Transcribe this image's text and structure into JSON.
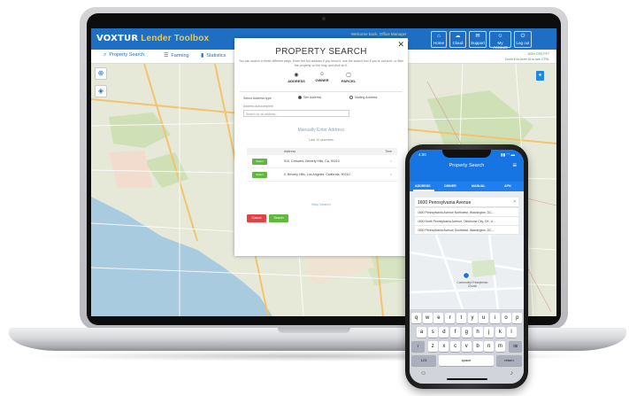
{
  "app": {
    "brand_prefix": "VOXTUR",
    "brand_suffix": "Lender Toolbox",
    "user_name": "Welcome back, Office Manager",
    "user_id": "User ID: 0123 (LEN)"
  },
  "header_nav": [
    {
      "label": "Home",
      "icon": "⌂"
    },
    {
      "label": "Cloud",
      "icon": "☁"
    },
    {
      "label": "Support",
      "icon": "✉"
    },
    {
      "label": "My Account",
      "icon": "☺"
    },
    {
      "label": "Log out",
      "icon": "⏻"
    }
  ],
  "tabs": [
    {
      "label": "Property Search",
      "icon": "⌕"
    },
    {
      "label": "Farming",
      "icon": "☰"
    },
    {
      "label": "Statistics",
      "icon": "▮"
    }
  ],
  "credits": {
    "line1": "100% CRS PFT",
    "line2": "Zoom in to level 15 to see CTRL"
  },
  "modal": {
    "title": "PROPERTY SEARCH",
    "subtitle": "You can search in three different ways. Enter the full address if you know it, use the search box if you're not sure, or filter the property on the map and click on it.",
    "search_types": [
      {
        "label": "ADDRESS",
        "icon": "◉"
      },
      {
        "label": "OWNER",
        "icon": "☺"
      },
      {
        "label": "PARCEL",
        "icon": "▢"
      }
    ],
    "address_type_label": "Select Address type",
    "radio_site": "Site Address",
    "radio_mailing": "Mailing Address",
    "search_label": "Address autocomplete",
    "search_placeholder": "Search for an address...",
    "manual_entry": "Manually Enter Address",
    "last_searches": "Last 10 searches",
    "table_header_address": "Address",
    "table_header_time": "Time",
    "select_label": "Select",
    "rows": [
      {
        "address": "910, Crescent, Beverly Hills, Ca, 90210"
      },
      {
        "address": "0, Beverly Hills, Los Angeles, California, 90210"
      }
    ],
    "map_search": "Map Search",
    "cancel": "Cancel",
    "search": "Search"
  },
  "phone": {
    "time": "4:00",
    "signal": "▮▮ ◠ ▬",
    "title": "Property Search",
    "tabs": [
      "ADDRESS",
      "OWNER",
      "MANUAL",
      "APN"
    ],
    "search_value": "1600 Pennsylvania Avenue",
    "suggestions": [
      "1600 Pennsylvania Avenue Northwest, Washington, DC,...",
      "1600 North Pennsylvania Avenue, Oklahoma City, OK, U...",
      "1600 Pennsylvania Avenue Southeast, Washington, DC,..."
    ],
    "map_label": "Community Presbyterian Church",
    "kb_row1": [
      "q",
      "w",
      "e",
      "r",
      "t",
      "y",
      "u",
      "i",
      "o",
      "p"
    ],
    "kb_row2": [
      "a",
      "s",
      "d",
      "f",
      "g",
      "h",
      "j",
      "k",
      "l"
    ],
    "kb_row3": [
      "z",
      "x",
      "c",
      "v",
      "b",
      "n",
      "m"
    ],
    "kb_num": "123",
    "kb_space": "space",
    "kb_return": "return"
  }
}
